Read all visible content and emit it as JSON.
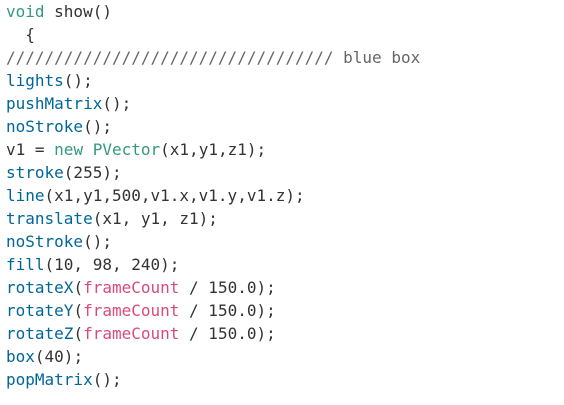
{
  "editor": {
    "lines": [
      [
        {
          "t": "void",
          "c": "kw"
        },
        {
          "t": " show()",
          "c": "plain"
        }
      ],
      [
        {
          "t": "  {",
          "c": "plain"
        }
      ],
      [
        {
          "t": "////////////////////////////////// blue box",
          "c": "comment"
        }
      ],
      [
        {
          "t": "lights",
          "c": "fn"
        },
        {
          "t": "();",
          "c": "plain"
        }
      ],
      [
        {
          "t": "pushMatrix",
          "c": "fn"
        },
        {
          "t": "();",
          "c": "plain"
        }
      ],
      [
        {
          "t": "noStroke",
          "c": "fn"
        },
        {
          "t": "();",
          "c": "plain"
        }
      ],
      [
        {
          "t": "v1 = ",
          "c": "plain"
        },
        {
          "t": "new",
          "c": "kw"
        },
        {
          "t": " ",
          "c": "plain"
        },
        {
          "t": "PVector",
          "c": "type"
        },
        {
          "t": "(x1,y1,z1);",
          "c": "plain"
        }
      ],
      [
        {
          "t": "stroke",
          "c": "fn"
        },
        {
          "t": "(255);",
          "c": "plain"
        }
      ],
      [
        {
          "t": "line",
          "c": "fn"
        },
        {
          "t": "(x1,y1,500,v1.x,v1.y,v1.z);",
          "c": "plain"
        }
      ],
      [
        {
          "t": "translate",
          "c": "fn"
        },
        {
          "t": "(x1, y1, z1);",
          "c": "plain"
        }
      ],
      [
        {
          "t": "noStroke",
          "c": "fn"
        },
        {
          "t": "();",
          "c": "plain"
        }
      ],
      [
        {
          "t": "fill",
          "c": "fn"
        },
        {
          "t": "(10, 98, 240);",
          "c": "plain"
        }
      ],
      [
        {
          "t": "rotateX",
          "c": "fn"
        },
        {
          "t": "(",
          "c": "plain"
        },
        {
          "t": "frameCount",
          "c": "var"
        },
        {
          "t": " / 150.0);",
          "c": "plain"
        }
      ],
      [
        {
          "t": "rotateY",
          "c": "fn"
        },
        {
          "t": "(",
          "c": "plain"
        },
        {
          "t": "frameCount",
          "c": "var"
        },
        {
          "t": " / 150.0);",
          "c": "plain"
        }
      ],
      [
        {
          "t": "rotateZ",
          "c": "fn"
        },
        {
          "t": "(",
          "c": "plain"
        },
        {
          "t": "frameCount",
          "c": "var"
        },
        {
          "t": " / 150.0);",
          "c": "plain"
        }
      ],
      [
        {
          "t": "box",
          "c": "fn"
        },
        {
          "t": "(40);",
          "c": "plain"
        }
      ],
      [
        {
          "t": "popMatrix",
          "c": "fn"
        },
        {
          "t": "();",
          "c": "plain"
        }
      ]
    ]
  },
  "colors": {
    "background": "#ffffff",
    "plain": "#333333",
    "keyword": "#33997e",
    "function": "#006699",
    "variable": "#d94a7a",
    "comment": "#666666"
  }
}
